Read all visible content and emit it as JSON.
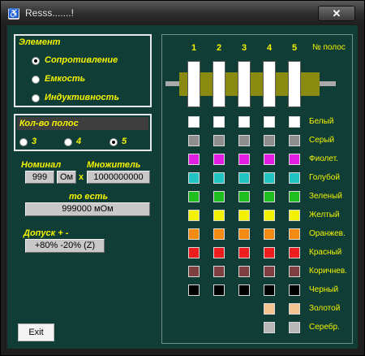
{
  "window": {
    "title": "Resss.......!",
    "close_glyph": "✕",
    "icon": "accessibility-icon"
  },
  "element_group": {
    "title": "Элемент",
    "options": [
      {
        "label": "Сопротивление",
        "selected": true
      },
      {
        "label": "Емкость",
        "selected": false
      },
      {
        "label": "Индуктивность",
        "selected": false
      }
    ]
  },
  "bands_group": {
    "title": "Кол-во полос",
    "options": [
      {
        "label": "3",
        "selected": false
      },
      {
        "label": "4",
        "selected": false
      },
      {
        "label": "5",
        "selected": true
      }
    ]
  },
  "nominal": {
    "label": "Номинал",
    "value": "999",
    "unit": "Ом",
    "times": "x"
  },
  "multiplier": {
    "label": "Множитель",
    "value": "1000000000"
  },
  "result": {
    "label": "то есть",
    "value": "999000 мОм"
  },
  "tolerance": {
    "label": "Допуск + -",
    "value": "+80% -20% (Z)"
  },
  "resistor": {
    "band_numbers": [
      "1",
      "2",
      "3",
      "4",
      "5"
    ],
    "bands_header": "№ полос",
    "body_color": "#8a8a10",
    "band_color": "#ffffff",
    "colors": [
      {
        "name": "Белый",
        "hex": "#ffffff",
        "columns": 5
      },
      {
        "name": "Серый",
        "hex": "#8e8e8e",
        "columns": 5
      },
      {
        "name": "Фиолет.",
        "hex": "#e31ee3",
        "columns": 5
      },
      {
        "name": "Голубой",
        "hex": "#22c3c3",
        "columns": 5
      },
      {
        "name": "Зеленый",
        "hex": "#1fbf1f",
        "columns": 5
      },
      {
        "name": "Желтый",
        "hex": "#f2f200",
        "columns": 5
      },
      {
        "name": "Оранжев.",
        "hex": "#f28a14",
        "columns": 5
      },
      {
        "name": "Красный",
        "hex": "#ee1e1e",
        "columns": 5
      },
      {
        "name": "Коричнев.",
        "hex": "#7d3f3f",
        "columns": 5
      },
      {
        "name": "Черный",
        "hex": "#000000",
        "columns": 5
      },
      {
        "name": "Золотой",
        "hex": "#f6c393",
        "columns": 2
      },
      {
        "name": "Серебр.",
        "hex": "#b8b8b8",
        "columns": 2
      }
    ]
  },
  "exit_button": {
    "label": "Exit"
  }
}
